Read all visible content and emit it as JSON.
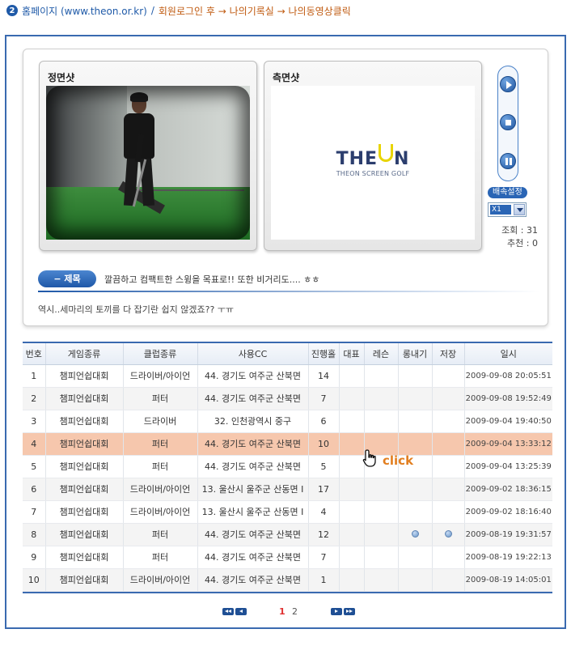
{
  "breadcrumb": {
    "step": "2",
    "home": "홈페이지 (www.theon.or.kr)",
    "path": "회원로그인 후 → 나의기록실 → 나의동영상클릭"
  },
  "player": {
    "front_title": "정면샷",
    "side_title": "측면샷",
    "logo": {
      "word_left": "THE",
      "word_right": "N",
      "sub": "THEON SCREEN GOLF"
    },
    "speed_label": "배속설정",
    "speed_value": "X1",
    "views_text": "조회 : 31",
    "recommend_text": "추천 : 0",
    "title_label": "− 제목",
    "title_text": "깔끔하고 컴팩트한 스윙을 목표로!! 또한 비거리도.... ㅎㅎ",
    "comment_text": "역시..세마리의 토끼를 다 잡기란 쉽지 않겠죠?? ㅜㅠ"
  },
  "table": {
    "headers": [
      "번호",
      "게임종류",
      "클럽종류",
      "사용CC",
      "진행홀",
      "대표",
      "레슨",
      "롱내기",
      "저장",
      "일시"
    ],
    "rows": [
      [
        "1",
        "챔피언쉽대회",
        "드라이버/아이언",
        "44. 경기도 여주군 산북면",
        "14",
        "",
        "",
        "",
        "",
        "2009-09-08 20:05:51"
      ],
      [
        "2",
        "챔피언쉽대회",
        "퍼터",
        "44. 경기도 여주군 산북면",
        "7",
        "",
        "",
        "",
        "",
        "2009-09-08 19:52:49"
      ],
      [
        "3",
        "챔피언쉽대회",
        "드라이버",
        "32. 인천광역시 중구",
        "6",
        "",
        "",
        "",
        "",
        "2009-09-04 19:40:50"
      ],
      [
        "4",
        "챔피언쉽대회",
        "퍼터",
        "44. 경기도 여주군 산북면",
        "10",
        "",
        "",
        "",
        "",
        "2009-09-04 13:33:12"
      ],
      [
        "5",
        "챔피언쉽대회",
        "퍼터",
        "44. 경기도 여주군 산북면",
        "5",
        "",
        "",
        "",
        "",
        "2009-09-04 13:25:39"
      ],
      [
        "6",
        "챔피언쉽대회",
        "드라이버/아이언",
        "13. 울산시 울주군 산동면 I",
        "17",
        "",
        "",
        "",
        "",
        "2009-09-02 18:36:15"
      ],
      [
        "7",
        "챔피언쉽대회",
        "드라이버/아이언",
        "13. 울산시 울주군 산동면 I",
        "4",
        "",
        "",
        "",
        "",
        "2009-09-02 18:16:40"
      ],
      [
        "8",
        "챔피언쉽대회",
        "퍼터",
        "44. 경기도 여주군 산북면",
        "12",
        "",
        "",
        "●",
        "●",
        "2009-08-19 19:31:57"
      ],
      [
        "9",
        "챔피언쉽대회",
        "퍼터",
        "44. 경기도 여주군 산북면",
        "7",
        "",
        "",
        "",
        "",
        "2009-08-19 19:22:13"
      ],
      [
        "10",
        "챔피언쉽대회",
        "드라이버/아이언",
        "44. 경기도 여주군 산북면",
        "1",
        "",
        "",
        "",
        "",
        "2009-08-19 14:05:01"
      ]
    ],
    "selected_row": 3
  },
  "annotation": {
    "click_text": "click"
  },
  "pager": {
    "current": "1",
    "other": "2"
  }
}
